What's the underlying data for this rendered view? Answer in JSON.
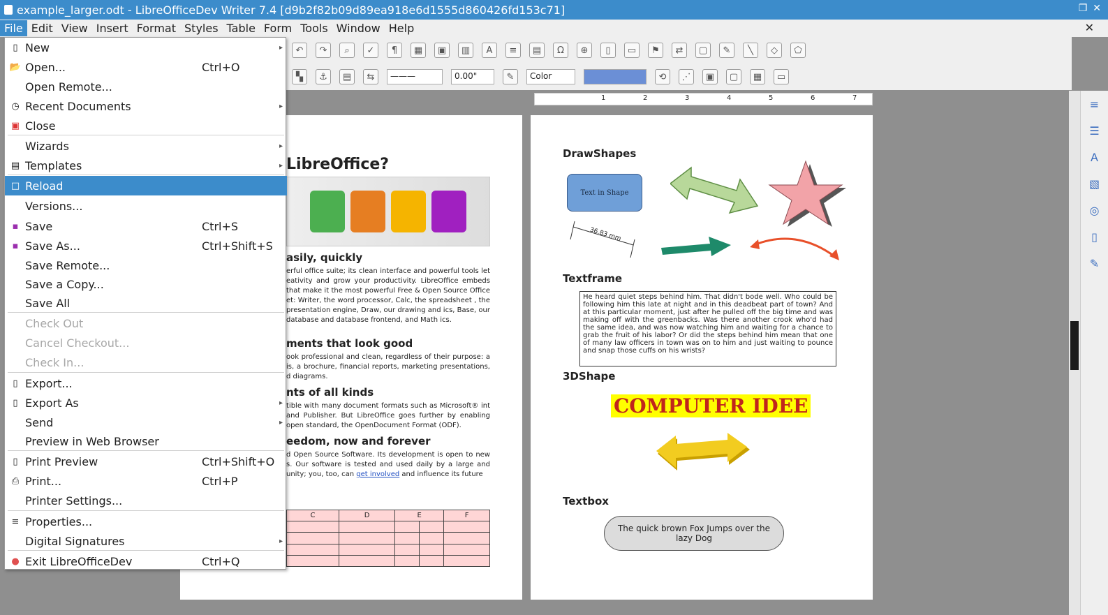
{
  "window": {
    "title": "example_larger.odt - LibreOfficeDev Writer 7.4 [d9b2f82b09d89ea918e6d1555d860426fd153c71]"
  },
  "menubar": [
    "File",
    "Edit",
    "View",
    "Insert",
    "Format",
    "Styles",
    "Table",
    "Form",
    "Tools",
    "Window",
    "Help"
  ],
  "toolbar2": {
    "line_width": "0.00\"",
    "area_style": "Color"
  },
  "ruler": [
    "1",
    "2",
    "3",
    "4",
    "5",
    "6",
    "7"
  ],
  "file_menu": [
    {
      "label": "New",
      "shortcut": "",
      "submenu": true,
      "icon": "new-document-icon",
      "state": "normal"
    },
    {
      "label": "Open...",
      "shortcut": "Ctrl+O",
      "submenu": false,
      "icon": "open-folder-icon",
      "state": "normal"
    },
    {
      "label": "Open Remote...",
      "shortcut": "",
      "submenu": false,
      "icon": "",
      "state": "normal"
    },
    {
      "label": "Recent Documents",
      "shortcut": "",
      "submenu": true,
      "icon": "recent-documents-icon",
      "state": "normal"
    },
    {
      "label": "Close",
      "shortcut": "",
      "submenu": false,
      "icon": "close-document-icon",
      "state": "normal"
    },
    {
      "label": "Wizards",
      "shortcut": "",
      "submenu": true,
      "icon": "",
      "state": "normal"
    },
    {
      "label": "Templates",
      "shortcut": "",
      "submenu": true,
      "icon": "templates-icon",
      "state": "normal"
    },
    {
      "label": "Reload",
      "shortcut": "",
      "submenu": false,
      "icon": "reload-icon",
      "state": "highlight"
    },
    {
      "label": "Versions...",
      "shortcut": "",
      "submenu": false,
      "icon": "",
      "state": "normal"
    },
    {
      "label": "Save",
      "shortcut": "Ctrl+S",
      "submenu": false,
      "icon": "save-icon",
      "state": "normal"
    },
    {
      "label": "Save As...",
      "shortcut": "Ctrl+Shift+S",
      "submenu": false,
      "icon": "save-as-icon",
      "state": "normal"
    },
    {
      "label": "Save Remote...",
      "shortcut": "",
      "submenu": false,
      "icon": "",
      "state": "normal"
    },
    {
      "label": "Save a Copy...",
      "shortcut": "",
      "submenu": false,
      "icon": "",
      "state": "normal"
    },
    {
      "label": "Save All",
      "shortcut": "",
      "submenu": false,
      "icon": "",
      "state": "normal"
    },
    {
      "label": "Check Out",
      "shortcut": "",
      "submenu": false,
      "icon": "",
      "state": "disabled"
    },
    {
      "label": "Cancel Checkout...",
      "shortcut": "",
      "submenu": false,
      "icon": "",
      "state": "disabled"
    },
    {
      "label": "Check In...",
      "shortcut": "",
      "submenu": false,
      "icon": "",
      "state": "disabled"
    },
    {
      "label": "Export...",
      "shortcut": "",
      "submenu": false,
      "icon": "export-icon",
      "state": "normal"
    },
    {
      "label": "Export As",
      "shortcut": "",
      "submenu": true,
      "icon": "export-as-icon",
      "state": "normal"
    },
    {
      "label": "Send",
      "shortcut": "",
      "submenu": true,
      "icon": "",
      "state": "normal"
    },
    {
      "label": "Preview in Web Browser",
      "shortcut": "",
      "submenu": false,
      "icon": "",
      "state": "normal"
    },
    {
      "label": "Print Preview",
      "shortcut": "Ctrl+Shift+O",
      "submenu": false,
      "icon": "print-preview-icon",
      "state": "normal"
    },
    {
      "label": "Print...",
      "shortcut": "Ctrl+P",
      "submenu": false,
      "icon": "printer-icon",
      "state": "normal"
    },
    {
      "label": "Printer Settings...",
      "shortcut": "",
      "submenu": false,
      "icon": "",
      "state": "normal"
    },
    {
      "label": "Properties...",
      "shortcut": "",
      "submenu": false,
      "icon": "properties-icon",
      "state": "normal"
    },
    {
      "label": "Digital Signatures",
      "shortcut": "",
      "submenu": true,
      "icon": "",
      "state": "normal"
    },
    {
      "label": "Exit LibreOfficeDev",
      "shortcut": "Ctrl+Q",
      "submenu": false,
      "icon": "exit-icon",
      "state": "normal"
    }
  ],
  "left_page": {
    "heading": "LibreOffice?",
    "sections": [
      {
        "title": "asily, quickly",
        "text": "erful office suite; its clean interface and powerful tools let eativity and grow your productivity. LibreOffice embeds that make it the most powerful Free & Open Source Office et: Writer, the word processor, Calc, the spreadsheet , the presentation engine, Draw, our drawing and ics, Base, our database and database frontend, and Math ics."
      },
      {
        "title": "ments that look good",
        "text": "ook professional and clean, regardless of their purpose: a is, a brochure, financial reports, marketing presentations, d diagrams."
      },
      {
        "title": "nts of all kinds",
        "text": "tible with many document formats such as Microsoft® int and Publisher. But LibreOffice goes further by enabling open standard, the OpenDocument Format (ODF)."
      },
      {
        "title": "eedom, now and forever",
        "text": "d Open Source Software. Its development is open to new s. Our software is tested and used daily by a large and unity; you, too, can",
        "link": "get involved",
        "text_after": "and influence its future"
      }
    ],
    "table_headers": [
      "C",
      "D",
      "E",
      "F"
    ]
  },
  "right_page": {
    "drawshapes_title": "DrawShapes",
    "shape_text": "Text in Shape",
    "dimension_label": "36.83 mm",
    "textframe_title": "Textframe",
    "textframe_body": "He heard quiet steps behind him. That didn't bode well. Who could be following him this late at night and in this deadbeat part of town? And at this particular moment, just after he pulled off the big time and was making off with the greenbacks. Was there another crook who'd had the same idea, and was now watching him and waiting for a chance to grab the fruit of his labor? Or did the steps behind him mean that one of many law officers in town was on to him and just waiting to pounce and snap those cuffs on his wrists?",
    "threed_title": "3DShape",
    "wordart": "COMPUTER IDEE",
    "textbox_title": "Textbox",
    "textbox_body": "The quick brown Fox Jumps over the lazy Dog"
  },
  "colors": {
    "accent": "#3c8ccb",
    "table_fill": "#ffd6d6",
    "arrow_green": "#1e8a6a",
    "arrow_red": "#e8502a",
    "star_pink": "#f2a3a8",
    "double_arrow": "#b8d89a"
  }
}
